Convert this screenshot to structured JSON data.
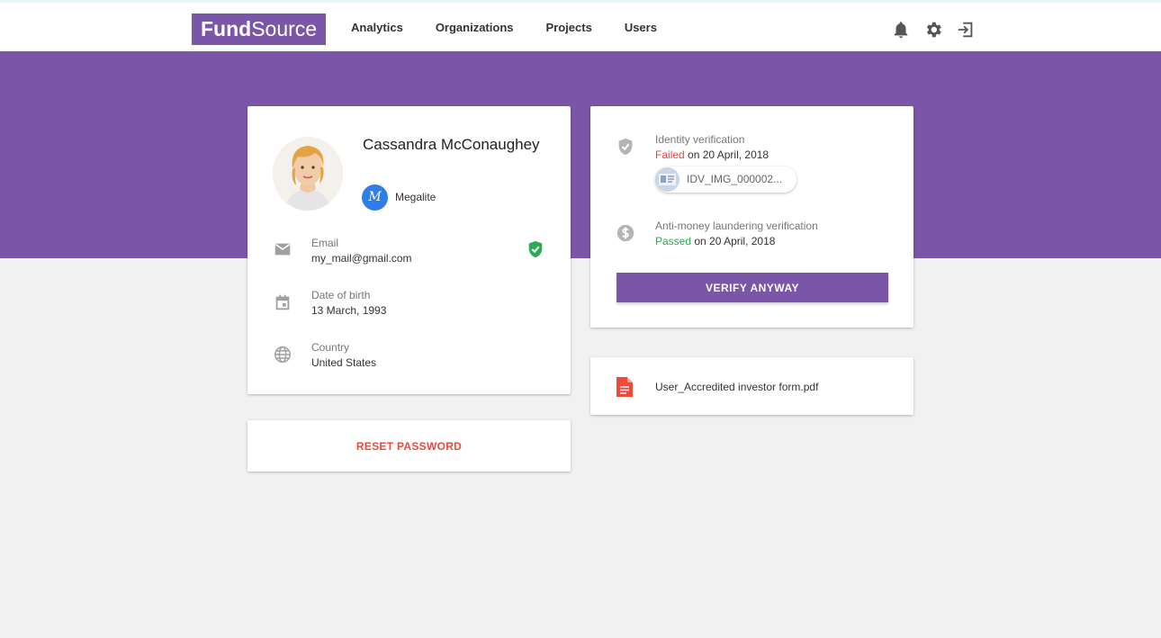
{
  "nav": {
    "logo_bold": "Fund",
    "logo_regular": "Source",
    "links": [
      "Analytics",
      "Organizations",
      "Projects",
      "Users"
    ],
    "icons": [
      "bell-icon",
      "gear-icon",
      "logout-icon"
    ]
  },
  "colors": {
    "brand": "#7b55a8",
    "failed": "#e8453c",
    "passed": "#2eaa55",
    "reset": "#e84b3c",
    "org_badge": "#2f7ee6"
  },
  "profile": {
    "name": "Cassandra McConaughey",
    "organization": {
      "logo_letter": "M",
      "name": "Megalite"
    },
    "email_label": "Email",
    "email": "my_mail@gmail.com",
    "email_verified_icon": "shield-check-icon",
    "dob_label": "Date of birth",
    "dob": "13 March, 1993",
    "country_label": "Country",
    "country": "United States"
  },
  "reset": {
    "label": "RESET PASSWORD"
  },
  "verification": {
    "identity": {
      "title": "Identity verification",
      "status": "Failed",
      "date_text": " on 20 April, 2018",
      "file": "IDV_IMG_000002..."
    },
    "aml": {
      "title": "Anti-money laundering verification",
      "status": "Passed",
      "date_text": " on 20 April, 2018"
    },
    "button_label": "VERIFY ANYWAY"
  },
  "document": {
    "filename": "User_Accredited investor form.pdf"
  }
}
